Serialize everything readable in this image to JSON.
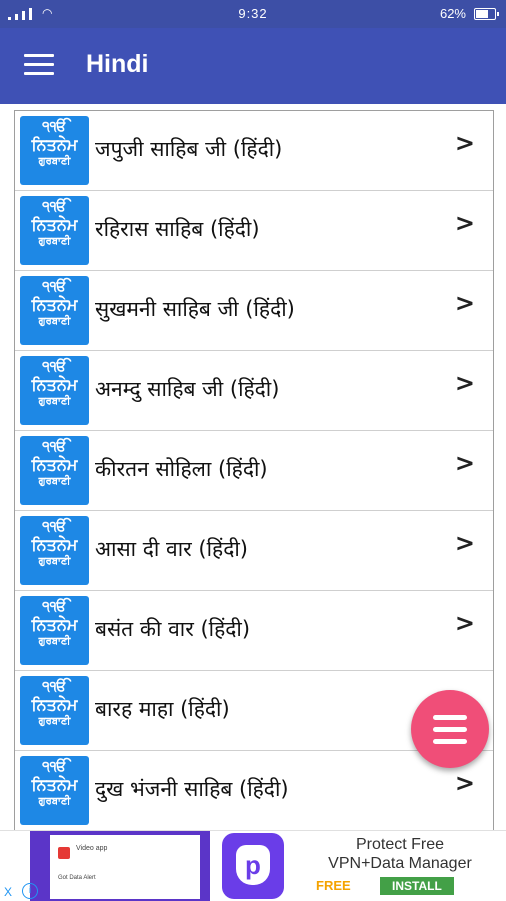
{
  "status_bar": {
    "time": "9:32",
    "battery": "62%"
  },
  "app_bar": {
    "title": "Hindi"
  },
  "logo": {
    "line1": "੧ੴ",
    "line2": "ਨਿਤਨੇਮ",
    "line3": "ਗੁਰਬਾਣੀ"
  },
  "items": [
    {
      "label": "जपुजी साहिब जी (हिंदी)"
    },
    {
      "label": "रहिरास साहिब (हिंदी)"
    },
    {
      "label": "सुखमनी साहिब जी (हिंदी)"
    },
    {
      "label": "अनम्दु साहिब जी (हिंदी)"
    },
    {
      "label": "कीरतन सोहिला (हिंदी)"
    },
    {
      "label": "आसा दी वार (हिंदी)"
    },
    {
      "label": "बसंत की वार (हिंदी)"
    },
    {
      "label": "बारह माहा (हिंदी)"
    },
    {
      "label": "दुख भंजनी साहिब (हिंदी)"
    }
  ],
  "chevron": ">",
  "ad": {
    "mock_title": "Video app",
    "mock_sub": "Got Data Alert",
    "icon_letter": "p",
    "headline1": "Protect Free",
    "headline2": "VPN+Data Manager",
    "free": "FREE",
    "install": "INSTALL",
    "close": "X",
    "info": "i"
  },
  "colors": {
    "status_bar": "#3d4fa6",
    "app_bar": "#3f51b5",
    "logo_bg": "#1e88e5",
    "fab": "#f04e78"
  }
}
